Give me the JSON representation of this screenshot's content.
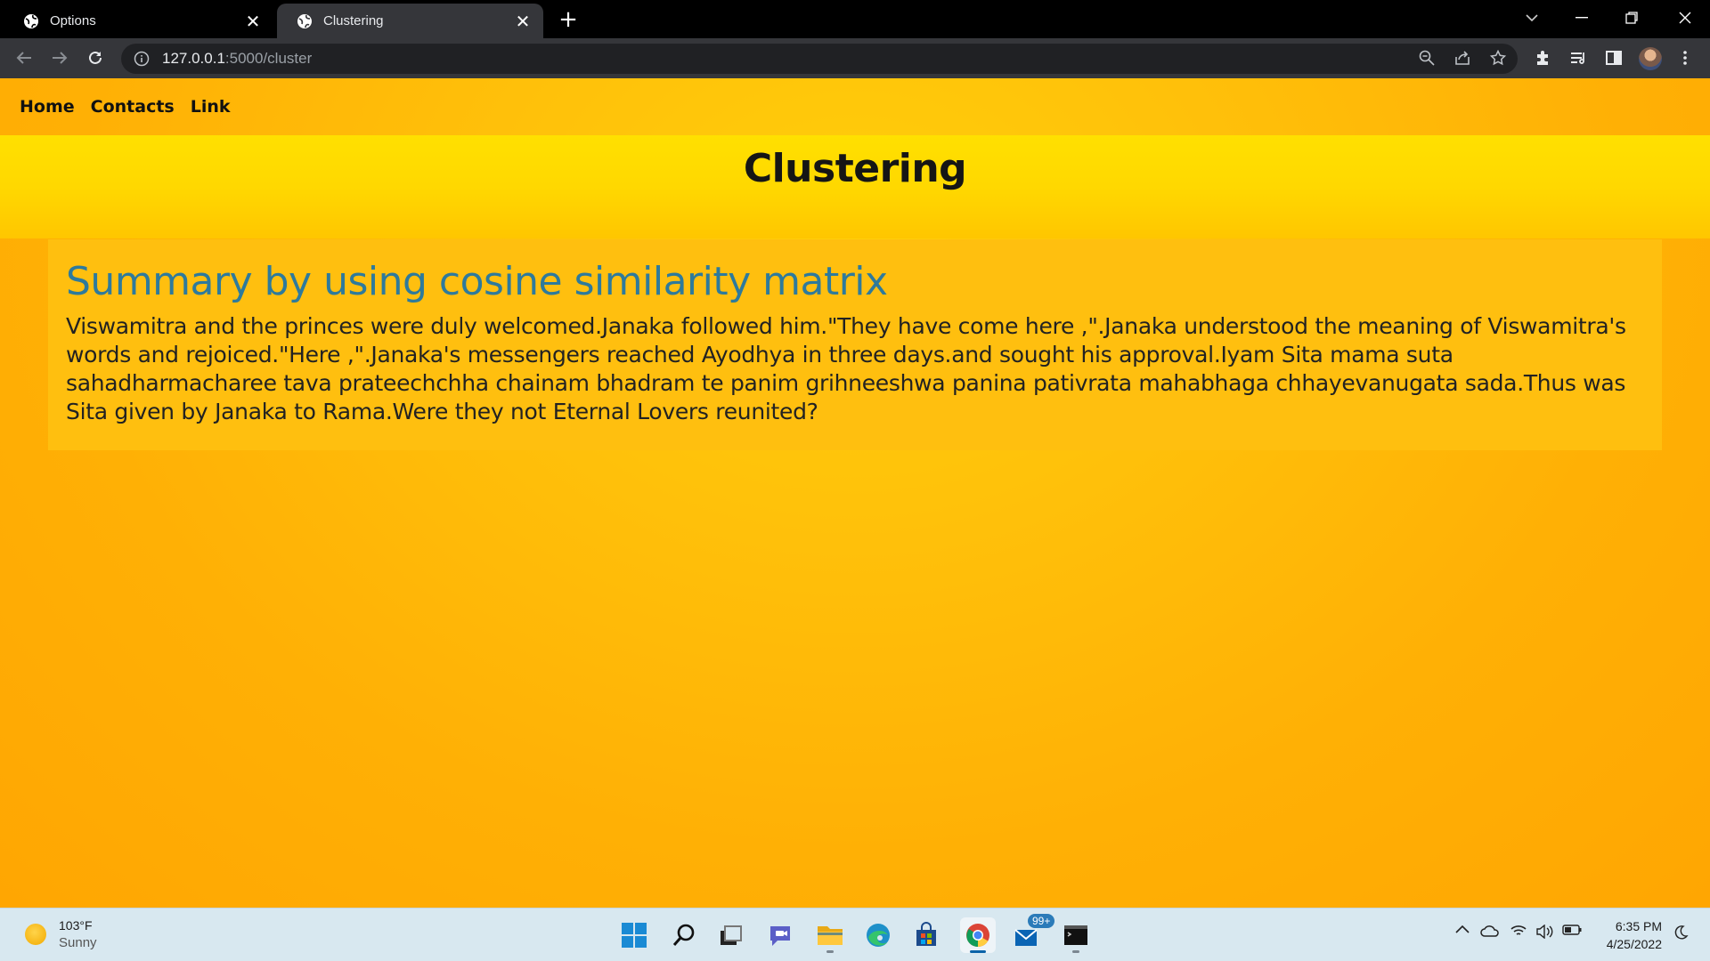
{
  "browser": {
    "tabs": [
      {
        "label": "Options",
        "active": false
      },
      {
        "label": "Clustering",
        "active": true
      }
    ],
    "new_tab": "+",
    "url_host": "127.0.0.1",
    "url_rest": ":5000/cluster"
  },
  "page": {
    "nav": [
      "Home",
      "Contacts",
      "Link"
    ],
    "heading": "Clustering",
    "summary_title": "Summary by using cosine similarity matrix",
    "summary_text": "Viswamitra and the princes were duly welcomed.Janaka followed him.\"They have come here ,\".Janaka understood the meaning of Viswamitra's words and rejoiced.\"Here ,\".Janaka's messengers reached Ayodhya in three days.and sought his approval.Iyam Sita mama suta sahadharmacharee tava prateechchha chainam bhadram te panim grihneeshwa panina pativrata mahabhaga chhayevanugata sada.Thus was Sita given by Janaka to Rama.Were they not Eternal Lovers reunited?",
    "colors": {
      "heading_blue": "#2e7a9c",
      "background": "#ffb005",
      "banner": "#ffe000"
    }
  },
  "taskbar": {
    "weather_temp": "103°F",
    "weather_cond": "Sunny",
    "mail_badge": "99+",
    "time": "6:35 PM",
    "date": "4/25/2022"
  }
}
